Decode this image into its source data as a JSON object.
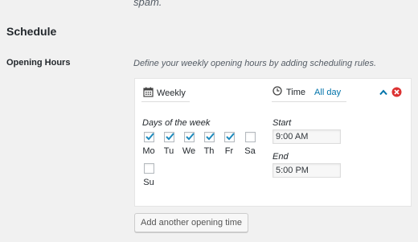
{
  "top_text": "spam.",
  "section": {
    "title": "Schedule"
  },
  "opening_hours": {
    "label": "Opening Hours",
    "description": "Define your weekly opening hours by adding scheduling rules."
  },
  "rule": {
    "frequency_label": "Weekly",
    "time_label": "Time",
    "all_day_label": "All day",
    "days_label": "Days of the week",
    "days": [
      {
        "name": "Mo",
        "checked": true
      },
      {
        "name": "Tu",
        "checked": true
      },
      {
        "name": "We",
        "checked": true
      },
      {
        "name": "Th",
        "checked": true
      },
      {
        "name": "Fr",
        "checked": true
      },
      {
        "name": "Sa",
        "checked": false
      },
      {
        "name": "Su",
        "checked": false
      }
    ],
    "start_label": "Start",
    "start_value": "9:00 AM",
    "end_label": "End",
    "end_value": "5:00 PM"
  },
  "add_button_label": "Add another opening time",
  "colors": {
    "accent": "#0073aa",
    "remove": "#dc3232",
    "check": "#1e8cbe"
  },
  "icons": {
    "frequency": "calendar-icon",
    "time": "clock-icon",
    "collapse": "chevron-up-icon",
    "remove": "remove-circle-icon"
  }
}
